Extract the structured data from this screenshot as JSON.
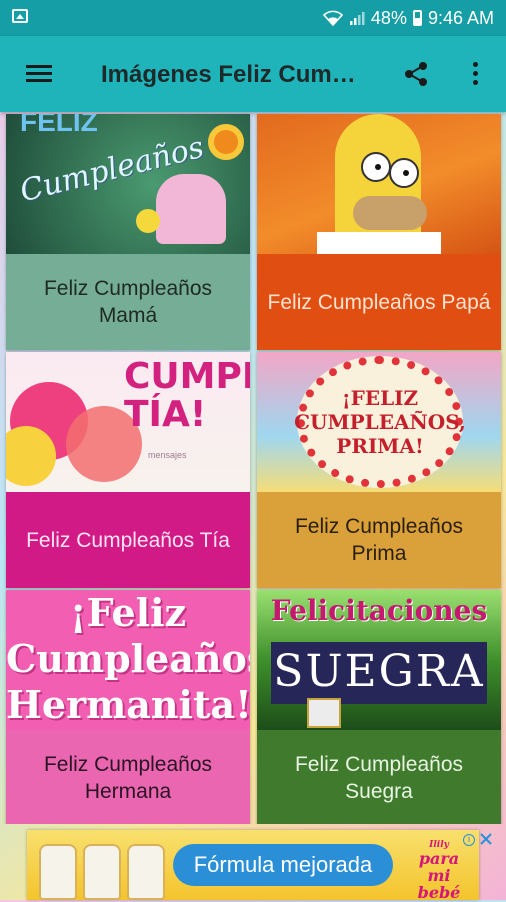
{
  "status_bar": {
    "battery": "48%",
    "time": "9:46 AM"
  },
  "toolbar": {
    "title": "Imágenes Feliz Cumpleaños",
    "icons": [
      "menu-icon",
      "share-icon",
      "more-icon"
    ]
  },
  "cards": [
    {
      "caption": "Feliz Cumpleaños Mamá",
      "caption_bg": "#76ad97",
      "caption_color": "#1e2a24"
    },
    {
      "caption": "Feliz Cumpleaños Papá",
      "caption_bg": "#e04e12",
      "caption_color": "#ffe2cf"
    },
    {
      "caption": "Feliz Cumpleaños Tía",
      "caption_bg": "#d11a86",
      "caption_color": "#ffe3f2"
    },
    {
      "caption": "Feliz Cumpleaños Prima",
      "caption_bg": "#daa13a",
      "caption_color": "#2a1e0d"
    },
    {
      "caption": "Feliz Cumpleaños Hermana",
      "caption_bg": "#ea66b0",
      "caption_color": "#2b1424"
    },
    {
      "caption": "Feliz Cumpleaños Suegra",
      "caption_bg": "#3f7a2d",
      "caption_color": "#e8f5e2"
    }
  ],
  "thumbnails": {
    "mama": {
      "top": "FELIZ",
      "word": "Cumpleaños"
    },
    "tia": {
      "text": "CUMPLE TÍA!",
      "small": "mensajes"
    },
    "prima": {
      "text": "¡FELIZ CUMPLEAÑOS, PRIMA!"
    },
    "hermana": {
      "text": "¡Feliz Cumpleaños Hermanita!"
    },
    "suegra": {
      "line1": "Felicitaciones",
      "line2": "SUEGRA"
    }
  },
  "ad": {
    "pill_text": "Fórmula mejorada",
    "brand_text": "para mi bebé",
    "brand_small": "Ilily"
  },
  "colors": {
    "status_bar": "#169ea6",
    "toolbar": "#1fb3ba"
  }
}
